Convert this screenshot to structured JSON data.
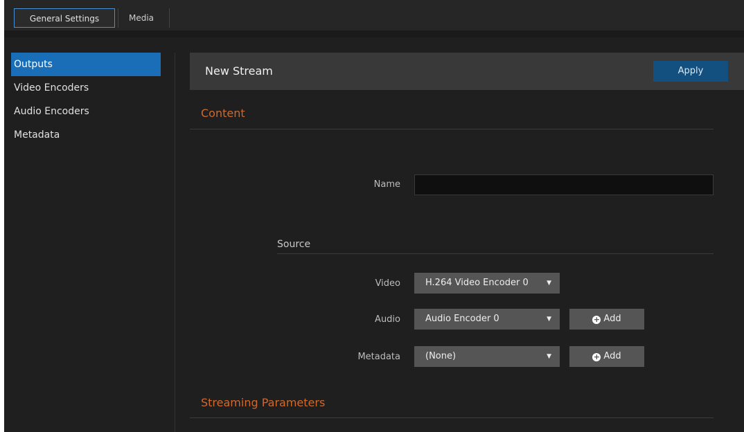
{
  "top_tabs": [
    {
      "label": "General Settings",
      "active": true
    },
    {
      "label": "Media",
      "active": false
    }
  ],
  "sidebar": {
    "items": [
      {
        "label": "Outputs",
        "active": true
      },
      {
        "label": "Video Encoders",
        "active": false
      },
      {
        "label": "Audio Encoders",
        "active": false
      },
      {
        "label": "Metadata",
        "active": false
      }
    ]
  },
  "header": {
    "title": "New Stream",
    "apply_label": "Apply"
  },
  "content": {
    "section_title": "Content",
    "name_label": "Name",
    "name_value": "",
    "source": {
      "title": "Source",
      "video_label": "Video",
      "video_value": "H.264 Video Encoder 0",
      "audio_label": "Audio",
      "audio_value": "Audio Encoder 0",
      "metadata_label": "Metadata",
      "metadata_value": "(None)",
      "add_label": "Add"
    }
  },
  "streaming": {
    "section_title": "Streaming Parameters"
  },
  "icons": {
    "caret": "caret-down-icon",
    "add": "plus-circle-icon"
  },
  "colors": {
    "accent": "#1a6eb8",
    "section_title": "#d0692c",
    "apply": "#13507f"
  }
}
